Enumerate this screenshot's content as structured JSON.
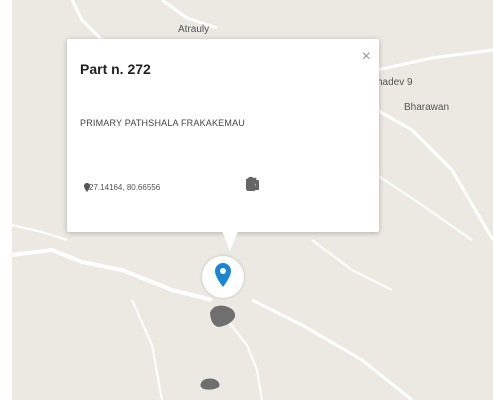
{
  "map": {
    "labels": {
      "atrauly": "Atrauly",
      "jhadev": "hadev 9",
      "bharawan": "Bharawan"
    }
  },
  "popup": {
    "title": "Part n. 272",
    "close": "×",
    "description": "PRIMARY PATHSHALA FRAKAKEMAU",
    "coordinates": "27.14164, 80.66556",
    "actions": [
      "fill-icon",
      "pencil-icon",
      "camera-icon",
      "branch-icon",
      "trash-icon"
    ]
  },
  "colors": {
    "marker": "#1a84d6",
    "polygon": "#6f6f6f",
    "map_bg": "#ece9e3",
    "road": "#ffffff"
  }
}
